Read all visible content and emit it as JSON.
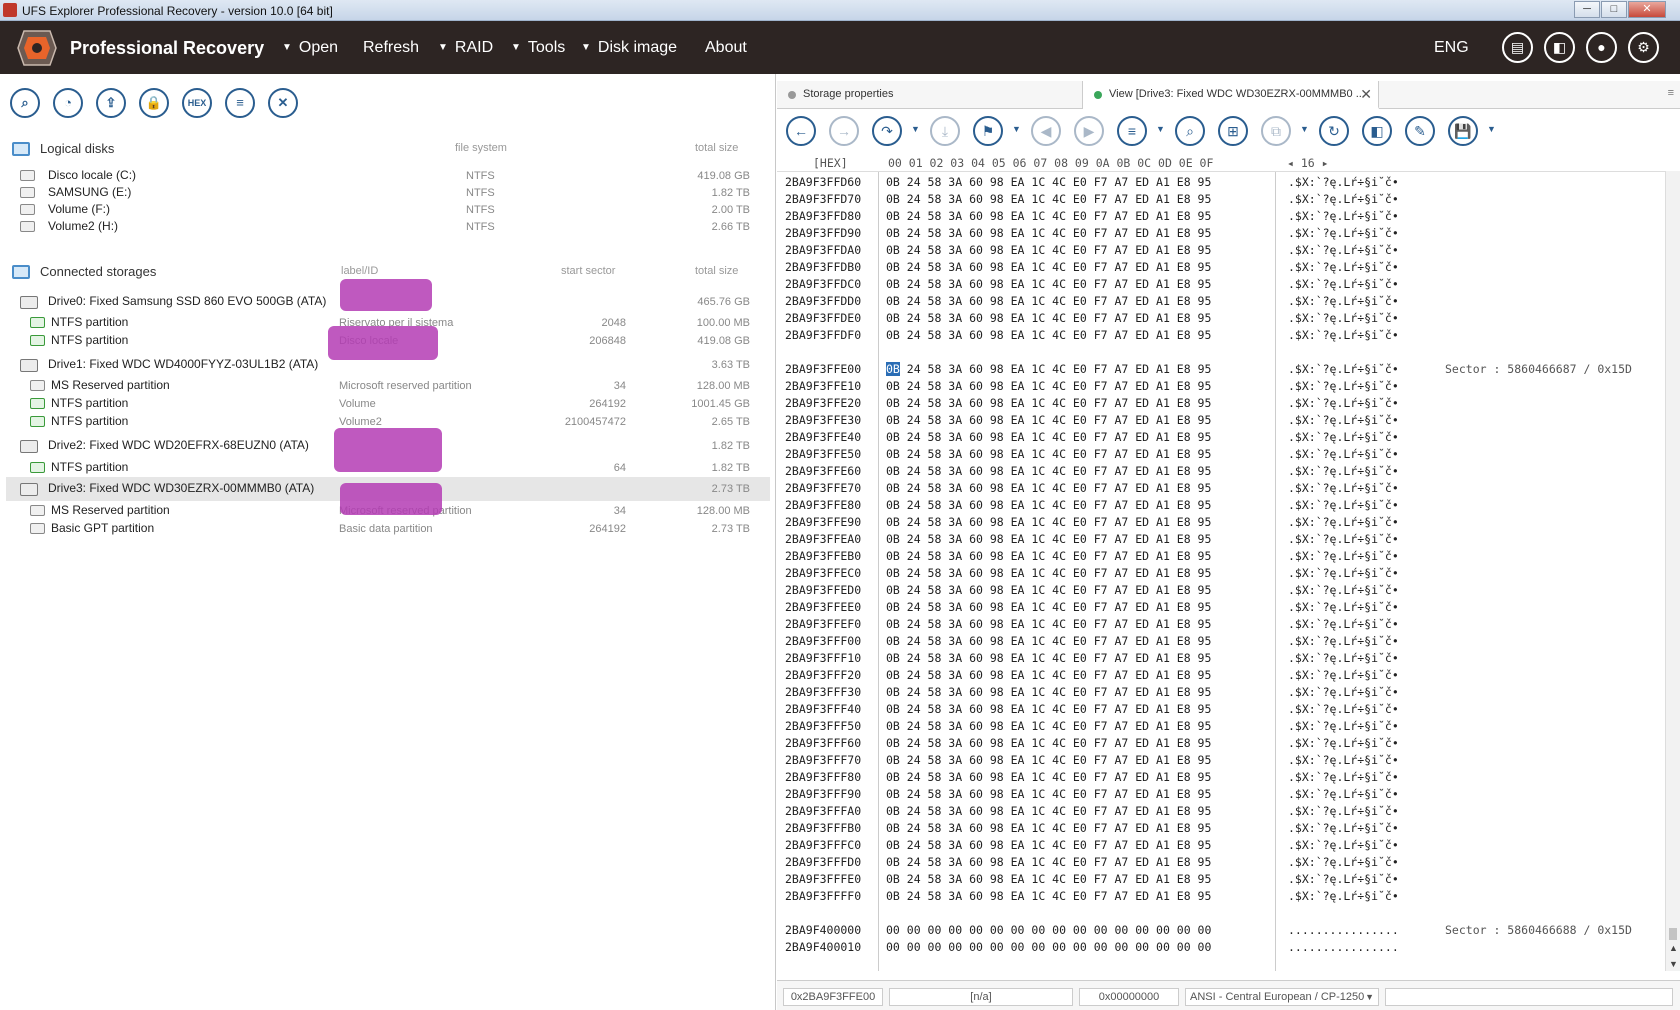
{
  "window": {
    "title": "UFS Explorer Professional Recovery - version 10.0 [64 bit]",
    "min": "─",
    "max": "□",
    "close": "✕"
  },
  "menubar": {
    "brand": "Professional Recovery",
    "items": [
      {
        "label": "Open",
        "has_caret": true
      },
      {
        "label": "Refresh",
        "has_caret": false
      },
      {
        "label": "RAID",
        "has_caret": true
      },
      {
        "label": "Tools",
        "has_caret": true
      },
      {
        "label": "Disk image",
        "has_caret": true
      },
      {
        "label": "About",
        "has_caret": false
      }
    ],
    "caret": "▼",
    "language": "ENG",
    "icons": [
      "news-icon",
      "panel-icon",
      "user-icon",
      "settings-icon"
    ],
    "icon_glyphs": [
      "▤",
      "◧",
      "●",
      "⚙"
    ]
  },
  "left_toolbar": {
    "hex_label": "HEX",
    "glyphs": [
      "⌕",
      "◔",
      "⇪",
      "🔒",
      "HEX",
      "≡",
      "✕"
    ]
  },
  "logical_disks": {
    "title": "Logical disks",
    "col_fs": "file system",
    "col_size": "total size",
    "items": [
      {
        "name": "Disco locale (C:)",
        "fs": "NTFS",
        "size": "419.08 GB"
      },
      {
        "name": "SAMSUNG (E:)",
        "fs": "NTFS",
        "size": "1.82 TB"
      },
      {
        "name": "Volume (F:)",
        "fs": "NTFS",
        "size": "2.00 TB"
      },
      {
        "name": "Volume2 (H:)",
        "fs": "NTFS",
        "size": "2.66 TB"
      }
    ]
  },
  "connected_storages": {
    "title": "Connected storages",
    "col_label": "label/ID",
    "col_start": "start sector",
    "col_size": "total size",
    "items": [
      {
        "kind": "drive",
        "name": "Drive0: Fixed Samsung SSD 860 EVO 500GB (ATA)",
        "label": "",
        "start": "",
        "size": "465.76 GB"
      },
      {
        "kind": "part",
        "name": "NTFS partition",
        "label": "Riservato per il sistema",
        "start": "2048",
        "size": "100.00 MB"
      },
      {
        "kind": "part",
        "name": "NTFS partition",
        "label": "Disco locale",
        "start": "206848",
        "size": "419.08 GB"
      },
      {
        "kind": "drive",
        "name": "Drive1: Fixed WDC WD4000FYYZ-03UL1B2 (ATA)",
        "label": "",
        "start": "",
        "size": "3.63 TB"
      },
      {
        "kind": "msr",
        "name": "MS Reserved partition",
        "label": "Microsoft reserved partition",
        "start": "34",
        "size": "128.00 MB"
      },
      {
        "kind": "part",
        "name": "NTFS partition",
        "label": "Volume",
        "start": "264192",
        "size": "1001.45 GB"
      },
      {
        "kind": "part",
        "name": "NTFS partition",
        "label": "Volume2",
        "start": "2100457472",
        "size": "2.65 TB"
      },
      {
        "kind": "drive",
        "name": "Drive2: Fixed WDC WD20EFRX-68EUZN0 (ATA)",
        "label": "",
        "start": "",
        "size": "1.82 TB"
      },
      {
        "kind": "part",
        "name": "NTFS partition",
        "label": "",
        "start": "64",
        "size": "1.82 TB"
      },
      {
        "kind": "drive",
        "name": "Drive3: Fixed WDC WD30EZRX-00MMMB0 (ATA)",
        "label": "",
        "start": "",
        "size": "2.73 TB",
        "selected": true
      },
      {
        "kind": "msr",
        "name": "MS Reserved partition",
        "label": "Microsoft reserved partition",
        "start": "34",
        "size": "128.00 MB"
      },
      {
        "kind": "msr",
        "name": "Basic GPT partition",
        "label": "Basic data partition",
        "start": "264192",
        "size": "2.73 TB"
      }
    ]
  },
  "tabs": [
    {
      "label": "Storage properties",
      "active": false
    },
    {
      "label": "View [Drive3: Fixed WDC WD30EZRX-00MMMB0 ...",
      "active": true,
      "close": "✕"
    }
  ],
  "tab_menu": "≡",
  "hex_toolbar_glyphs": [
    "←",
    "→",
    "↷",
    "⤓",
    "⚑",
    "◀",
    "▶",
    "≡",
    "⌕",
    "⊞",
    "⧉",
    "↻",
    "◧",
    "✎",
    "💾"
  ],
  "hex_view": {
    "offset_header": "[HEX]",
    "columns": "00 01 02 03 04 05 06 07 08 09 0A 0B 0C 0D 0E 0F",
    "nav": "◂ 16 ▸",
    "pattern_bytes": "0B 24 58 3A 60 98 EA 1C 4C E0 F7 A7 ED A1 E8 95",
    "pattern_text": ".$X:`?ę.Lŕ÷§i˘č•",
    "zero_bytes": "00 00 00 00 00 00 00 00 00 00 00 00 00 00 00 00",
    "zero_text": "................",
    "rows_before": [
      "2BA9F3FFD60",
      "2BA9F3FFD70",
      "2BA9F3FFD80",
      "2BA9F3FFD90",
      "2BA9F3FFDA0",
      "2BA9F3FFDB0",
      "2BA9F3FFDC0",
      "2BA9F3FFDD0",
      "2BA9F3FFDE0",
      "2BA9F3FFDF0"
    ],
    "sector_rows": [
      "2BA9F3FFE00",
      "2BA9F3FFE10",
      "2BA9F3FFE20",
      "2BA9F3FFE30",
      "2BA9F3FFE40",
      "2BA9F3FFE50",
      "2BA9F3FFE60",
      "2BA9F3FFE70",
      "2BA9F3FFE80",
      "2BA9F3FFE90",
      "2BA9F3FFEA0",
      "2BA9F3FFEB0",
      "2BA9F3FFEC0",
      "2BA9F3FFED0",
      "2BA9F3FFEE0",
      "2BA9F3FFEF0",
      "2BA9F3FFF00",
      "2BA9F3FFF10",
      "2BA9F3FFF20",
      "2BA9F3FFF30",
      "2BA9F3FFF40",
      "2BA9F3FFF50",
      "2BA9F3FFF60",
      "2BA9F3FFF70",
      "2BA9F3FFF80",
      "2BA9F3FFF90",
      "2BA9F3FFFA0",
      "2BA9F3FFFB0",
      "2BA9F3FFFC0",
      "2BA9F3FFFD0",
      "2BA9F3FFFE0",
      "2BA9F3FFFF0"
    ],
    "zero_rows": [
      "2BA9F400000",
      "2BA9F400010"
    ],
    "sector1_label": "Sector : 5860466687 / 0x15D",
    "sector2_label": "Sector : 5860466688 / 0x15D"
  },
  "status": {
    "offset": "0x2BA9F3FFE00",
    "value": "[n/a]",
    "addr": "0x00000000",
    "encoding": "ANSI - Central European / CP-1250",
    "encoding_caret": "▼"
  },
  "colors": {
    "menubar_bg": "#2d2523",
    "accent_blue": "#2a5d8f",
    "selection": "#2a6db5",
    "redaction": "#b43cb4"
  }
}
